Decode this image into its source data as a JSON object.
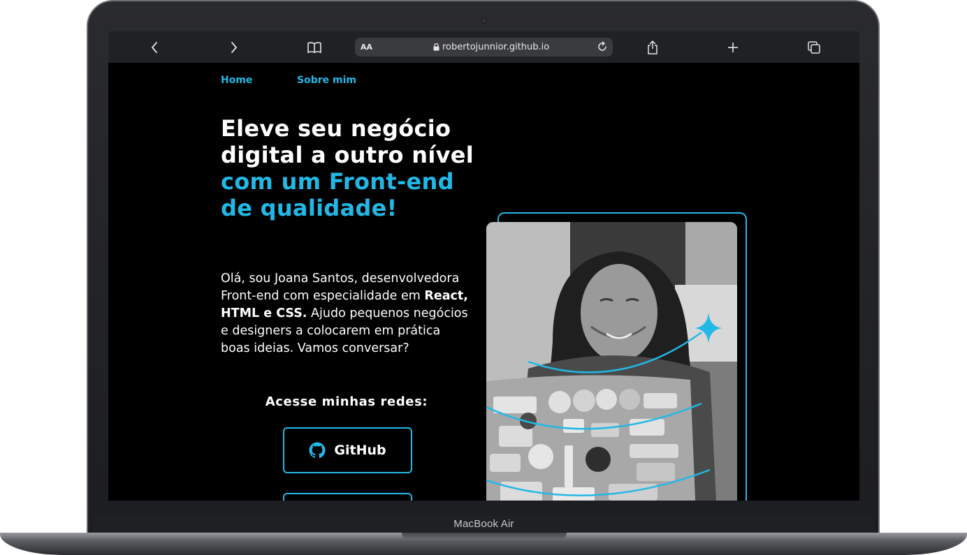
{
  "device": {
    "label": "MacBook Air"
  },
  "browser": {
    "text_size_label": "AA",
    "url": "robertojunnior.github.io",
    "icons": [
      "chevron-left-icon",
      "chevron-right-icon",
      "book-icon",
      "lock-icon",
      "reload-icon",
      "share-icon",
      "plus-icon",
      "tabs-icon"
    ]
  },
  "nav": {
    "items": [
      {
        "label": "Home"
      },
      {
        "label": "Sobre mim"
      }
    ]
  },
  "hero": {
    "headline_white": "Eleve seu negócio digital a outro nível",
    "headline_accent": "com um Front-end de qualidade!",
    "intro_part1": "Olá, sou Joana Santos, desenvolvedora Front-end com especialidade em",
    "intro_bold1": "React, HTML e CSS.",
    "intro_part2": "Ajudo pequenos negócios e designers a colocarem em prática boas ideias. Vamos conversar?",
    "networks_title": "Acesse minhas redes:",
    "social_buttons": [
      {
        "label": "GitHub",
        "icon": "github-icon"
      },
      {
        "label": "",
        "icon": ""
      }
    ]
  },
  "colors": {
    "accent": "#22b8e6",
    "page_background": "#000000",
    "text": "#ffffff"
  }
}
